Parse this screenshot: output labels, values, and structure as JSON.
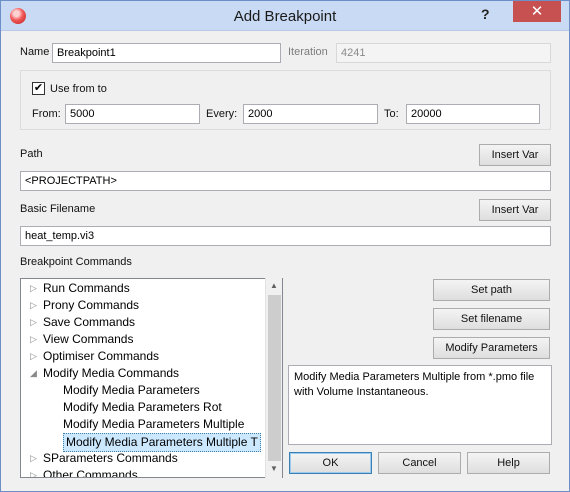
{
  "window": {
    "title": "Add Breakpoint",
    "help_label": "?",
    "close_label": "✕"
  },
  "name": {
    "label": "Name",
    "value": "Breakpoint1"
  },
  "iteration": {
    "label": "Iteration",
    "value": "4241"
  },
  "range": {
    "checkbox_label": "Use from to",
    "checked": true,
    "from_label": "From:",
    "from_value": "5000",
    "every_label": "Every:",
    "every_value": "2000",
    "to_label": "To:",
    "to_value": "20000"
  },
  "path": {
    "label": "Path",
    "value": "<PROJECTPATH>",
    "button": "Insert Var"
  },
  "filename": {
    "label": "Basic Filename",
    "value": "heat_temp.vi3",
    "button": "Insert Var"
  },
  "commands": {
    "label": "Breakpoint Commands",
    "tree": [
      {
        "text": "Run Commands",
        "level": 0,
        "arrow": "▷"
      },
      {
        "text": "Prony Commands",
        "level": 0,
        "arrow": "▷"
      },
      {
        "text": "Save Commands",
        "level": 0,
        "arrow": "▷"
      },
      {
        "text": "View Commands",
        "level": 0,
        "arrow": "▷"
      },
      {
        "text": "Optimiser Commands",
        "level": 0,
        "arrow": "▷"
      },
      {
        "text": "Modify Media Commands",
        "level": 0,
        "arrow": "◢"
      },
      {
        "text": "Modify Media Parameters",
        "level": 1,
        "arrow": ""
      },
      {
        "text": "Modify Media Parameters Rot",
        "level": 1,
        "arrow": ""
      },
      {
        "text": "Modify Media Parameters Multiple",
        "level": 1,
        "arrow": ""
      },
      {
        "text": "Modify Media Parameters Multiple T",
        "level": 1,
        "arrow": "",
        "selected": true
      },
      {
        "text": "SParameters Commands",
        "level": 0,
        "arrow": "▷"
      },
      {
        "text": "Other Commands",
        "level": 0,
        "arrow": "▷"
      }
    ],
    "buttons": {
      "set_path": "Set path",
      "set_filename": "Set filename",
      "modify_parameters": "Modify Parameters"
    },
    "description": "Modify Media Parameters Multiple from *.pmo file with Volume Instantaneous."
  },
  "footer": {
    "ok": "OK",
    "cancel": "Cancel",
    "help": "Help"
  },
  "colors": {
    "titlebar": "#c9daf4",
    "close": "#c75050",
    "selection": "#cce8ff"
  }
}
